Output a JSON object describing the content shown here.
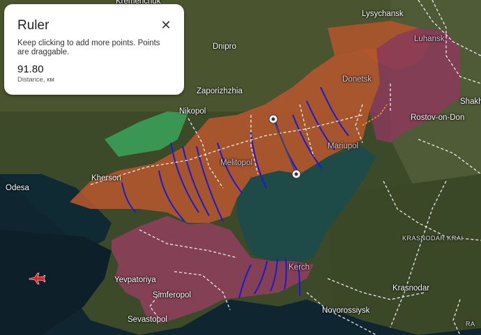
{
  "panel": {
    "title": "Ruler",
    "close_icon": "close-icon",
    "hint": "Keep clicking to add more points. Points are draggable.",
    "distance_value": "91.80",
    "distance_unit": "Distance, км"
  },
  "labels": {
    "kremenchuk": "Kremenchuk",
    "lysychansk": "Lysychansk",
    "luhansk": "Luhansk",
    "dnipro": "Dnipro",
    "zaporizhzhia": "Zaporizhzhia",
    "nikopol": "Nikopol",
    "donetsk": "Donetsk",
    "shakh": "Shakh",
    "rostov": "Rostov-on-Don",
    "mariupol": "Mariupol",
    "melitopol": "Melitopol",
    "kherson": "Kherson",
    "odesa": "Odesa",
    "krasnodar_krai": "KRASNODAR KRAI",
    "kerch": "Kerch",
    "krasnodar": "Krasnodar",
    "yevpatoriya": "Yevpatoriya",
    "simferopol": "Simferopol",
    "novorossiysk": "Novorossiysk",
    "sevastopol": "Sevastopol",
    "ra": "RA"
  },
  "icons": {
    "plane": "aircraft-icon",
    "ruler_point": "ruler-point-icon"
  },
  "colors": {
    "occupied": "#b5562c",
    "occupied_pre": "#8a3a5a",
    "ukraine_liberated": "#3aa35a",
    "defense_lines": "#1a1ad0",
    "ruler_line": "#444466",
    "sea": "#1d4a4a",
    "boundary": "#ffffff"
  }
}
